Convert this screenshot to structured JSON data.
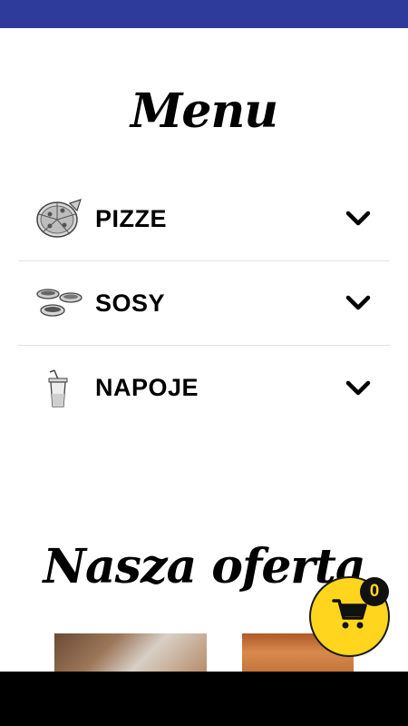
{
  "menu": {
    "title": "Menu",
    "items": [
      {
        "label": "PIZZE",
        "icon": "pizza-icon"
      },
      {
        "label": "SOSY",
        "icon": "sauce-bowls-icon"
      },
      {
        "label": "NAPOJE",
        "icon": "drink-cup-icon"
      }
    ]
  },
  "offer": {
    "title": "Nasza oferta"
  },
  "cart": {
    "count": "0",
    "icon": "cart-icon"
  },
  "colors": {
    "status_bar": "#2f3b9a",
    "fab": "#ffd51e",
    "badge": "#111111"
  }
}
